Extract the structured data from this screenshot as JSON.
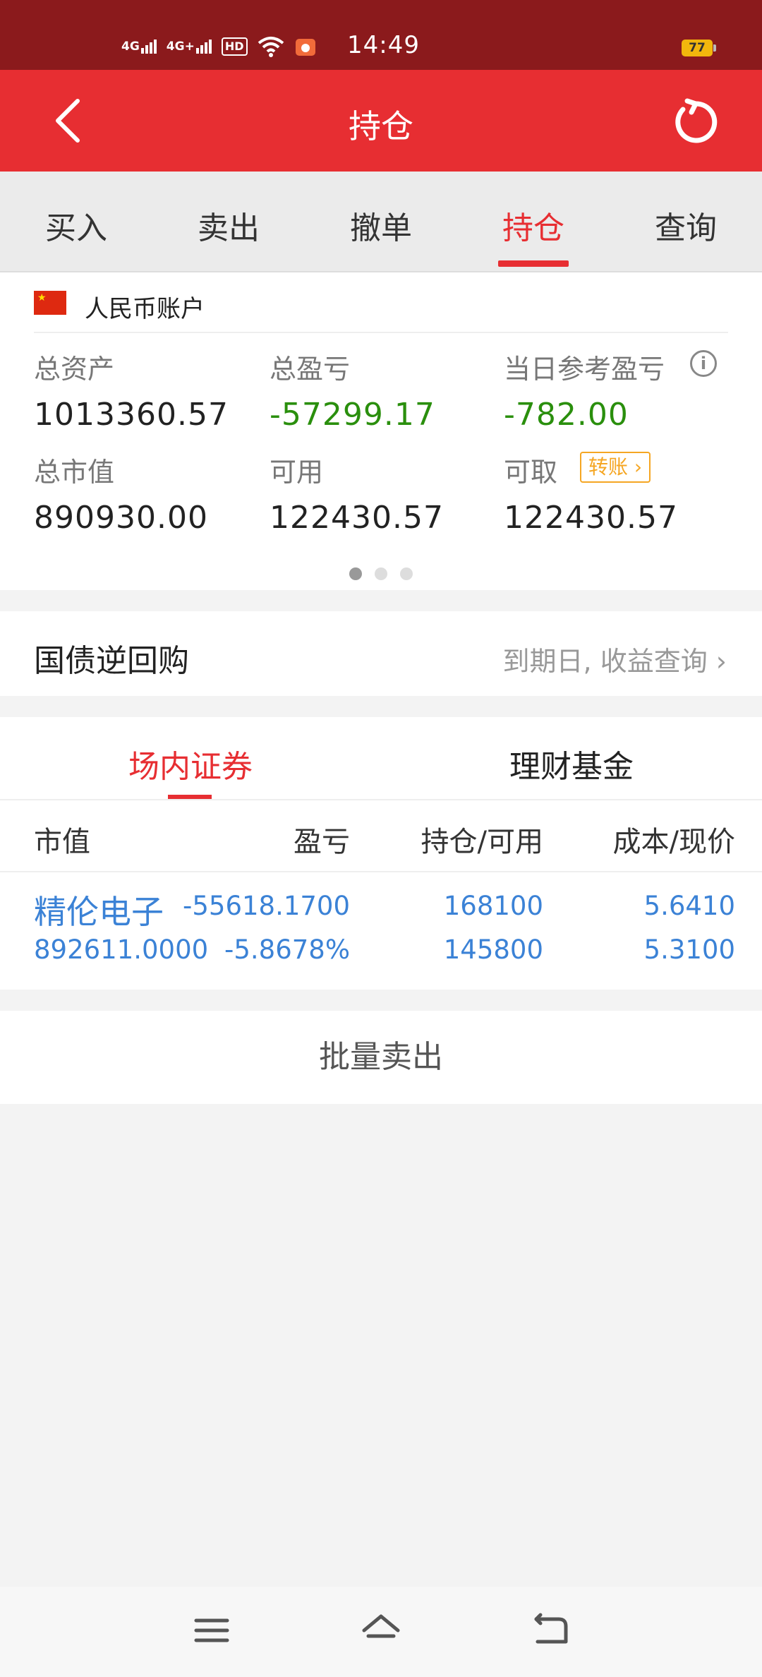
{
  "status_bar": {
    "signal_1": "4G",
    "signal_2": "4G+",
    "hd": "HD",
    "time": "14:49",
    "battery": "77"
  },
  "header": {
    "title": "持仓",
    "back_icon": "chevron-left-icon",
    "refresh_icon": "refresh-icon"
  },
  "tabs": [
    {
      "label": "买入"
    },
    {
      "label": "卖出"
    },
    {
      "label": "撤单"
    },
    {
      "label": "持仓",
      "active": true
    },
    {
      "label": "查询"
    }
  ],
  "account": {
    "name": "人民币账户",
    "total_assets_label": "总资产",
    "total_assets": "1013360.57",
    "total_pl_label": "总盈亏",
    "total_pl": "-57299.17",
    "daily_pl_label": "当日参考盈亏",
    "daily_pl": "-782.00",
    "market_value_label": "总市值",
    "market_value": "890930.00",
    "available_label": "可用",
    "available": "122430.57",
    "withdrawable_label": "可取",
    "withdrawable": "122430.57",
    "transfer_label": "转账"
  },
  "repo": {
    "title": "国债逆回购",
    "link": "到期日, 收益查询"
  },
  "holdings": {
    "subtabs": [
      {
        "label": "场内证券",
        "active": true
      },
      {
        "label": "理财基金"
      }
    ],
    "columns": [
      "市值",
      "盈亏",
      "持仓/可用",
      "成本/现价"
    ],
    "rows": [
      {
        "name": "精伦电子",
        "market_value": "892611.0000",
        "pl": "-55618.1700",
        "pl_pct": "-5.8678%",
        "position": "168100",
        "available": "145800",
        "cost": "5.6410",
        "price": "5.3100"
      }
    ]
  },
  "batch_sell": "批量卖出",
  "colors": {
    "status_bar": "#8b1a1c",
    "brand_red": "#e72e32",
    "loss_green": "#2a8f0d",
    "link_blue": "#3b82d6",
    "transfer_orange": "#f5a623"
  }
}
